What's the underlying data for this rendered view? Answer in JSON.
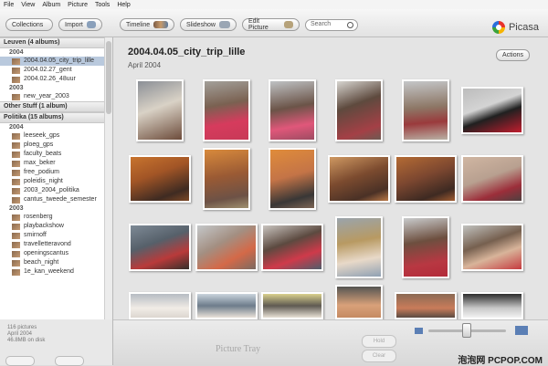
{
  "menu": [
    "File",
    "View",
    "Album",
    "Picture",
    "Tools",
    "Help"
  ],
  "toolbar": {
    "collections_label": "Collections",
    "import_label": "Import",
    "timeline_label": "Timeline",
    "slideshow_label": "Slideshow",
    "edit_picture_label": "Edit Picture",
    "search_label": "Search",
    "logo_text": "Picasa"
  },
  "sidebar": {
    "folder_leuven": "Leuven (4 albums)",
    "year_2004_a": "2004",
    "leuven_albums": [
      "2004.04.05_city_trip_lille",
      "2004.02.27_gent",
      "2004.02.26_48uur"
    ],
    "year_2003_a": "2003",
    "leuven_albums_2003": [
      "new_year_2003"
    ],
    "folder_other": "Other Stuff (1 album)",
    "folder_politika": "Politika (15 albums)",
    "year_2004_b": "2004",
    "politika_albums": [
      "leeseek_gps",
      "ploeg_gps",
      "faculty_beats",
      "max_beker",
      "free_podium",
      "poleidis_night",
      "2003_2004_politika",
      "cantus_tweede_semester"
    ],
    "year_2003_b": "2003",
    "politika_albums_2003": [
      "rosenberg",
      "playbackshow",
      "smirnoff",
      "travelletteravond",
      "openingscantus",
      "beach_night",
      "1e_kan_weekend"
    ]
  },
  "status": {
    "line1": "116 pictures",
    "line2": "April 2004",
    "line3": "46.8MB on disk"
  },
  "main": {
    "album_title": "2004.04.05_city_trip_lille",
    "album_date": "April 2004",
    "actions_label": "Actions"
  },
  "tray": {
    "caption": "Picture Tray",
    "hold_label": "Hold",
    "clear_label": "Clear"
  },
  "watermark": "泡泡网 PCPOP.COM",
  "colors": {
    "selection": "#b9c9dd",
    "accent": "#5b7fb5"
  }
}
